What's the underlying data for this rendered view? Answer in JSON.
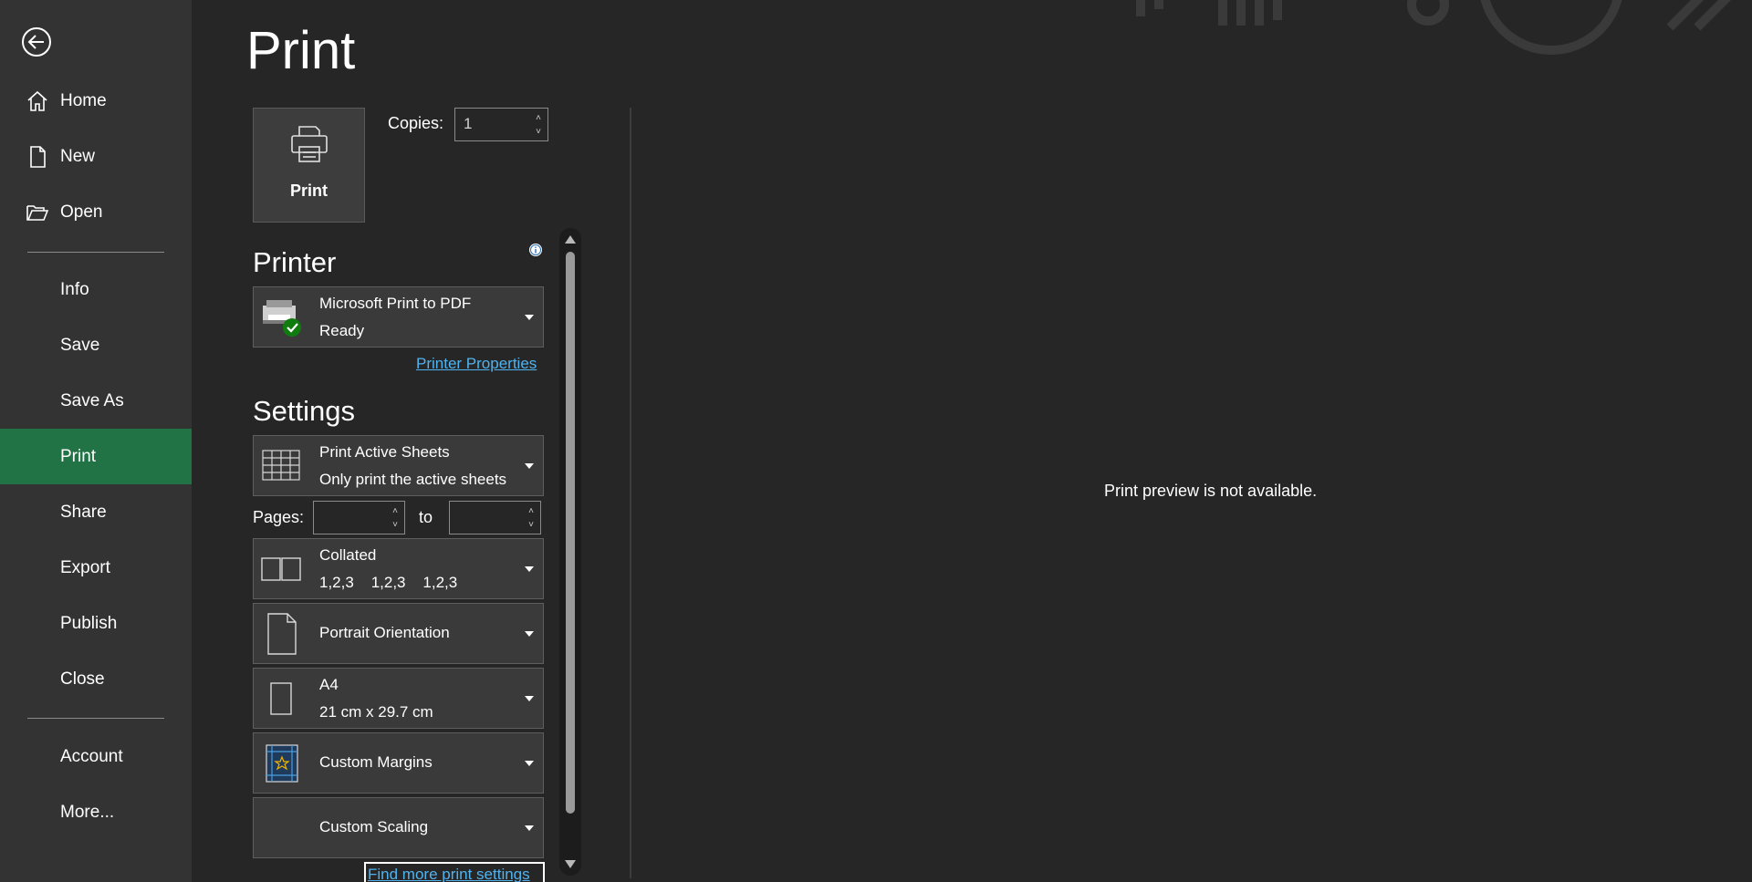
{
  "nav": {
    "back_icon": "back-arrow-icon",
    "items": [
      {
        "label": "Home",
        "icon": "home-icon"
      },
      {
        "label": "New",
        "icon": "new-file-icon"
      },
      {
        "label": "Open",
        "icon": "open-folder-icon"
      },
      {
        "label": "Info"
      },
      {
        "label": "Save"
      },
      {
        "label": "Save As"
      },
      {
        "label": "Print",
        "selected": true
      },
      {
        "label": "Share"
      },
      {
        "label": "Export"
      },
      {
        "label": "Publish"
      },
      {
        "label": "Close"
      },
      {
        "label": "Account"
      },
      {
        "label": "More..."
      }
    ],
    "selected_color": "#217346"
  },
  "page": {
    "title": "Print"
  },
  "print_button": {
    "label": "Print",
    "icon": "printer-icon"
  },
  "copies": {
    "label": "Copies:",
    "value": "1"
  },
  "printer": {
    "heading": "Printer",
    "name": "Microsoft Print to PDF",
    "status": "Ready",
    "icon": "printer-ready-icon",
    "info_icon": "info-icon",
    "properties_link": "Printer Properties"
  },
  "settings": {
    "heading": "Settings",
    "what": {
      "line1": "Print Active Sheets",
      "line2": "Only print the active sheets",
      "icon": "sheet-grid-icon"
    },
    "pages_label": "Pages:",
    "pages_from": "",
    "to_label": "to",
    "pages_to": "",
    "collation": {
      "line1": "Collated",
      "line2": "1,2,3    1,2,3    1,2,3",
      "icon": "collated-icon"
    },
    "orientation": {
      "line1": "Portrait Orientation",
      "icon": "portrait-page-icon"
    },
    "paper": {
      "line1": "A4",
      "line2": "21 cm x 29.7 cm",
      "icon": "paper-size-icon"
    },
    "margins": {
      "line1": "Custom Margins",
      "icon": "custom-margins-icon"
    },
    "scaling": {
      "line1": "Custom Scaling"
    },
    "more_link": "Find more print settings"
  },
  "preview": {
    "message": "Print preview is not available."
  }
}
